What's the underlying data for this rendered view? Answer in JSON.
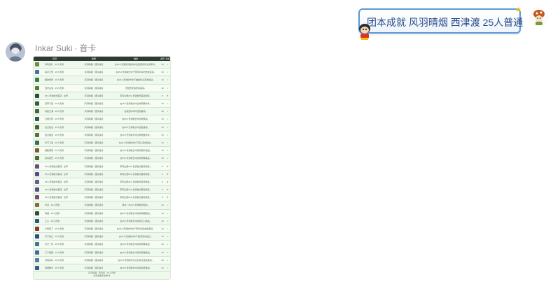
{
  "outgoing": {
    "text": "团本成就 风羽晴烟 西津渡 25人普通"
  },
  "incoming": {
    "sender_name": "Inkar Suki",
    "sender_separator": "·",
    "sender_tag": "音卡",
    "image": {
      "headers": [
        "名称",
        "类型",
        "描述",
        "资历",
        "状态"
      ],
      "rows": [
        {
          "name": "风吹雨打 · 25人普通",
          "type": "风羽晴烟 · 团队秘境",
          "desc": "在25人普通模式秘境中击败首领时达成条件。",
          "points": "10",
          "status": "done",
          "icon": "#6b8f3a"
        },
        {
          "name": "晴空万里 · 25人普通",
          "type": "风羽晴烟 · 团队秘境",
          "desc": "在25人普通模式中于限定时间内击败首领。",
          "points": "10",
          "status": "done",
          "icon": "#4a6fa5"
        },
        {
          "name": "烟波浩渺 · 25人普通",
          "type": "风羽晴烟 · 团队秘境",
          "desc": "在25人普通模式中不触发机关完成挑战。",
          "points": "10",
          "status": "done",
          "icon": "#3b7a57"
        },
        {
          "name": "西津古渡 · 25人普通",
          "type": "风羽晴烟 · 团队秘境",
          "desc": "击败西津渡所有首领。",
          "points": "10",
          "status": "done",
          "icon": "#5d7c2f"
        },
        {
          "name": "25人普通模式首领 · 全甲",
          "type": "风羽晴烟 · 团队秘境",
          "desc": "带有全部25人普通模式首领成就。",
          "points": "5",
          "status": "fail",
          "icon": "#2e4a3f"
        },
        {
          "name": "百转千回 · 25人普通",
          "type": "风羽晴烟 · 团队秘境",
          "desc": "在25人普通模式中达成特殊条件。",
          "points": "10",
          "status": "done",
          "icon": "#385c3c"
        },
        {
          "name": "风起云涌 · 25人普通",
          "type": "风羽晴烟 · 团队秘境",
          "desc": "在规定时间内击败首领。",
          "points": "10",
          "status": "done",
          "icon": "#44683a"
        },
        {
          "name": "云卷云舒 · 25人普通",
          "type": "风羽晴烟 · 团队秘境",
          "desc": "在25人普通模式中完成挑战。",
          "points": "10",
          "status": "done",
          "icon": "#2f5a49"
        },
        {
          "name": "渡口夜泊 · 25人普通",
          "type": "风羽晴烟 · 团队秘境",
          "desc": "在25人普通模式中击败首领。",
          "points": "10",
          "status": "done",
          "icon": "#4b5f2a"
        },
        {
          "name": "渡口相逢 · 25人普通",
          "type": "风羽晴烟 · 团队秘境",
          "desc": "在25人普通模式中达成相逢条件。",
          "points": "10",
          "status": "done",
          "icon": "#5a6f3c"
        },
        {
          "name": "津门飞渡 · 25人普通",
          "type": "风羽晴烟 · 团队秘境",
          "desc": "在25人普通模式中不死亡完成挑战。",
          "points": "10",
          "status": "done",
          "icon": "#3f6b5f"
        },
        {
          "name": "潮起潮落 · 25人普通",
          "type": "风羽晴烟 · 团队秘境",
          "desc": "在25人普通模式中完成潮汐挑战。",
          "points": "10",
          "status": "done",
          "icon": "#7a5c2f"
        },
        {
          "name": "孤舟蓑笠 · 25人普通",
          "type": "风羽晴烟 · 团队秘境",
          "desc": "在25人普通模式中完成特殊挑战。",
          "points": "10",
          "status": "done",
          "icon": "#4d6b3a"
        },
        {
          "name": "25人普通模式首领 · 全甲",
          "type": "风羽晴烟 · 团队秘境",
          "desc": "带有全部25人普通模式首领成就。",
          "points": "5",
          "status": "fail",
          "icon": "#6a4e7a"
        },
        {
          "name": "25人普通模式首领 · 全甲",
          "type": "风羽晴烟 · 团队秘境",
          "desc": "带有全部25人普通模式首领成就。",
          "points": "5",
          "status": "fail",
          "icon": "#5a4a8a"
        },
        {
          "name": "25人普通模式首领 · 全甲",
          "type": "风羽晴烟 · 团队秘境",
          "desc": "带有全部25人普通模式首领成就。",
          "points": "5",
          "status": "fail",
          "icon": "#6b5a9a"
        },
        {
          "name": "25人普通模式首领 · 全甲",
          "type": "风羽晴烟 · 团队秘境",
          "desc": "带有全部25人普通模式首领成就。",
          "points": "5",
          "status": "fail",
          "icon": "#5b4f7f"
        },
        {
          "name": "25人普通模式首领 · 全甲",
          "type": "风羽晴烟 · 团队秘境",
          "desc": "带有全部25人普通模式首领成就。",
          "points": "5",
          "status": "fail",
          "icon": "#7a4f6a"
        },
        {
          "name": "风羽 · 25人普通",
          "type": "风羽晴烟 · 团队秘境",
          "desc": "通关一次25人普通模式秘境。",
          "points": "10",
          "status": "done",
          "icon": "#8a6a3a"
        },
        {
          "name": "晴烟 · 25人普通",
          "type": "风羽晴烟 · 团队秘境",
          "desc": "在25人普通模式中完成晴烟挑战。",
          "points": "10",
          "status": "done",
          "icon": "#3a4a3a"
        },
        {
          "name": "江心 · 25人普通",
          "type": "风羽晴烟 · 团队秘境",
          "desc": "在25人普通模式中完成江心挑战。",
          "points": "10",
          "status": "done",
          "icon": "#2a5a7a"
        },
        {
          "name": "夕阳西下 · 25人普通",
          "type": "风羽晴烟 · 团队秘境",
          "desc": "在25人普通模式中于黄昏时段击败首领。",
          "points": "10",
          "status": "done",
          "icon": "#8a3a2a"
        },
        {
          "name": "月下渡江 · 25人普通",
          "type": "风羽晴烟 · 团队秘境",
          "desc": "在25人普通模式中于夜间完成渡江。",
          "points": "10",
          "status": "done",
          "icon": "#2a4a8a"
        },
        {
          "name": "水天一色 · 25人普通",
          "type": "风羽晴烟 · 团队秘境",
          "desc": "在25人普通模式中完成特殊挑战。",
          "points": "10",
          "status": "done",
          "icon": "#3a7a8a"
        },
        {
          "name": "三千里路 · 25人普通",
          "type": "风羽晴烟 · 团队秘境",
          "desc": "在25人普通模式中完成远程挑战。",
          "points": "10",
          "status": "done",
          "icon": "#4a6a9a"
        },
        {
          "name": "风雨同舟 · 25人普通",
          "type": "风羽晴烟 · 团队秘境",
          "desc": "在25人普通模式中全员存活击败首领。",
          "points": "10",
          "status": "done",
          "icon": "#5a7aaa"
        },
        {
          "name": "晴烟散尽 · 25人普通",
          "type": "风羽晴烟 · 团队秘境",
          "desc": "在25人普通模式中完成最终挑战。",
          "points": "10",
          "status": "done",
          "icon": "#3a5a8a"
        }
      ],
      "footer_line1": "风羽晴烟 · 西津渡 · 25人普通",
      "footer_line2": "成就数据仅供参考"
    }
  },
  "colors": {
    "bubble_border": "#5b9bd5",
    "bubble_text": "#2a4d8a",
    "table_header": "#2f3a36",
    "table_bg": "#eef8ec"
  }
}
